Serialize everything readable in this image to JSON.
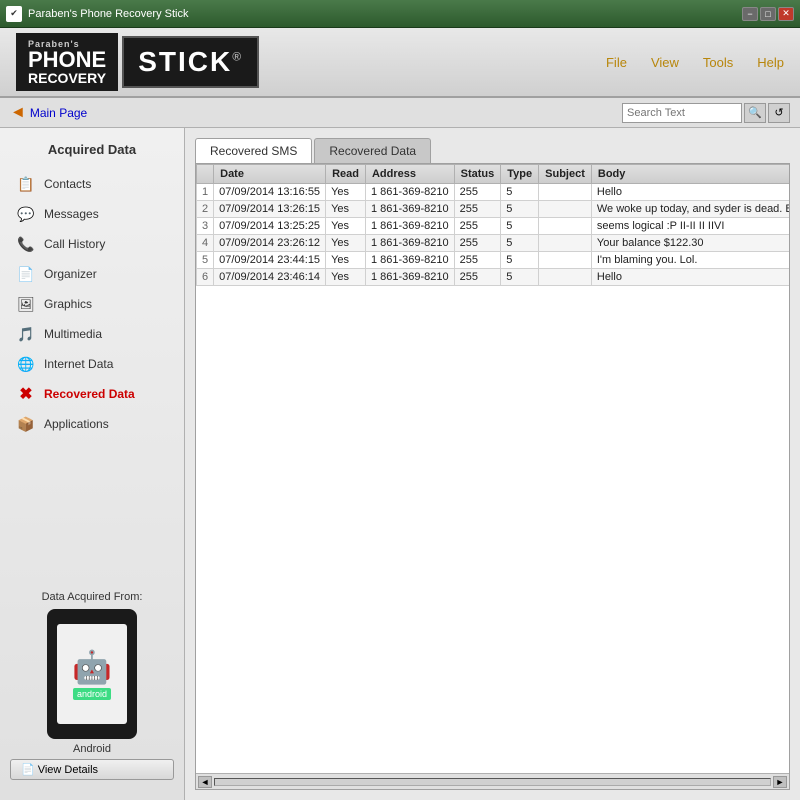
{
  "titleBar": {
    "title": "Paraben's Phone Recovery Stick",
    "controls": {
      "min": "−",
      "max": "□",
      "close": "✕"
    }
  },
  "header": {
    "logo": {
      "paraben": "Paraben's",
      "phone": "PHONE",
      "recovery": "RECOVERY",
      "stick": "STICK"
    },
    "menu": [
      {
        "id": "file",
        "label": "File"
      },
      {
        "id": "view",
        "label": "View"
      },
      {
        "id": "tools",
        "label": "Tools"
      },
      {
        "id": "help",
        "label": "Help"
      }
    ]
  },
  "navbar": {
    "mainPage": "Main Page",
    "search": {
      "placeholder": "Search Text"
    }
  },
  "sidebar": {
    "sectionTitle": "Acquired Data",
    "items": [
      {
        "id": "contacts",
        "label": "Contacts",
        "icon": "📋"
      },
      {
        "id": "messages",
        "label": "Messages",
        "icon": "💬"
      },
      {
        "id": "callHistory",
        "label": "Call History",
        "icon": "📞"
      },
      {
        "id": "organizer",
        "label": "Organizer",
        "icon": "📄"
      },
      {
        "id": "graphics",
        "label": "Graphics",
        "icon": "🖼"
      },
      {
        "id": "multimedia",
        "label": "Multimedia",
        "icon": "🎵"
      },
      {
        "id": "internetData",
        "label": "Internet Data",
        "icon": "🌐"
      },
      {
        "id": "recoveredData",
        "label": "Recovered Data",
        "icon": "✖",
        "active": true
      },
      {
        "id": "applications",
        "label": "Applications",
        "icon": "📦"
      }
    ],
    "deviceSection": {
      "label": "Data Acquired From:",
      "deviceName": "Android",
      "viewDetailsBtn": "View Details"
    }
  },
  "content": {
    "tabs": [
      {
        "id": "recoveredSMS",
        "label": "Recovered SMS",
        "active": true
      },
      {
        "id": "recoveredData",
        "label": "Recovered Data",
        "active": false
      }
    ],
    "tableHeaders": [
      "",
      "Date",
      "Read",
      "Address",
      "Status",
      "Type",
      "Subject",
      "Body"
    ],
    "tableRows": [
      {
        "num": "1",
        "date": "07/09/2014 13:16:55",
        "read": "Yes",
        "address": "1 861-369-8210",
        "status": "255",
        "type": "5",
        "subject": "",
        "body": "Hello"
      },
      {
        "num": "2",
        "date": "07/09/2014 13:26:15",
        "read": "Yes",
        "address": "1 861-369-8210",
        "status": "255",
        "type": "5",
        "subject": "",
        "body": "We woke up today, and syder is dead. Back Country"
      },
      {
        "num": "3",
        "date": "07/09/2014 13:25:25",
        "read": "Yes",
        "address": "1 861-369-8210",
        "status": "255",
        "type": "5",
        "subject": "",
        "body": "seems logical :P  II-II II IIVI"
      },
      {
        "num": "4",
        "date": "07/09/2014 23:26:12",
        "read": "Yes",
        "address": "1 861-369-8210",
        "status": "255",
        "type": "5",
        "subject": "",
        "body": "Your balance $122.30"
      },
      {
        "num": "5",
        "date": "07/09/2014 23:44:15",
        "read": "Yes",
        "address": "1 861-369-8210",
        "status": "255",
        "type": "5",
        "subject": "",
        "body": "I'm blaming you. Lol."
      },
      {
        "num": "6",
        "date": "07/09/2014 23:46:14",
        "read": "Yes",
        "address": "1 861-369-8210",
        "status": "255",
        "type": "5",
        "subject": "",
        "body": "Hello"
      }
    ]
  }
}
